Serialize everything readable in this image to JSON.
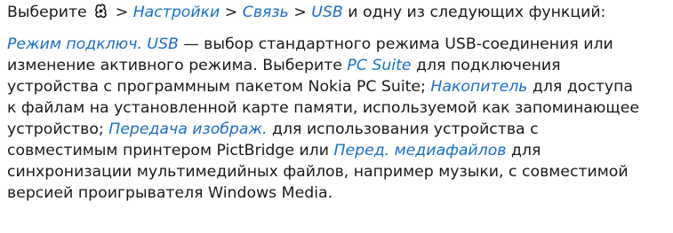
{
  "intro": {
    "prefix": "Выберите",
    "sep1": " > ",
    "settings": "Настройки",
    "sep2": " > ",
    "connectivity": "Связь",
    "sep3": " > ",
    "usb": "USB",
    "suffix": " и одну из следующих функций:",
    "menu_icon": "menu-key-icon"
  },
  "paragraph": {
    "l1_link": "Режим подключ. USB",
    "l1_text": " — выбор стандартного режима USB-соединения или",
    "l2_text": "изменение активного режима. Выберите ",
    "l2_link": "PC Suite",
    "l2_text2": " для подключения",
    "l3_text": "устройства с программным пакетом Nokia PC Suite; ",
    "l3_link": "Накопитель",
    "l3_text2": " для доступа",
    "l4_text": "к файлам на установленной карте памяти, используемой как запоминающее",
    "l5_text": "устройство; ",
    "l5_link": "Передача изображ.",
    "l5_text2": " для использования устройства с",
    "l6_text": "совместимым принтером PictBridge или ",
    "l6_link": "Перед. медиафайлов",
    "l6_text2": " для",
    "l7_text": "синхронизации мультимедийных файлов, например музыки, с совместимой",
    "l8_text": "версией проигрывателя Windows Media."
  },
  "colors": {
    "link": "#1a6fc4",
    "text": "#1a1a1a"
  }
}
